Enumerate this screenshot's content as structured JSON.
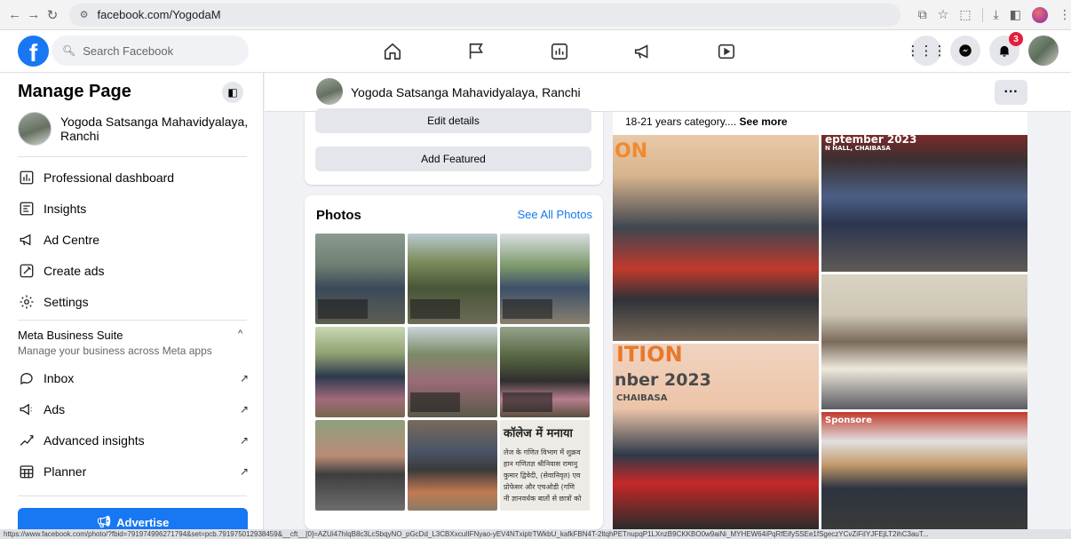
{
  "browser": {
    "url": "facebook.com/YogodaM",
    "status_url": "https://www.facebook.com/photo/?fbid=791974996271794&set=pcb.791975012938459&__cft__[0]=AZUi47hIqB8c3LcSbqyNO_pGcDd_L3CBXxcuIIFNyao-yEV4NTxiptrTWkbU_kafkFBN4T-2ltqhPETnupqP1LXnzB9CKKBO0w9aiNi_MYHEW64iPqRfEifySSEe1fSgeczYCvZiFiIYJFEjLT2ihC3auT..."
  },
  "fb": {
    "search_placeholder": "Search Facebook",
    "notif_count": "3"
  },
  "sidebar": {
    "title": "Manage Page",
    "page_name": "Yogoda Satsanga Mahavidyalaya, Ranchi",
    "items": [
      {
        "label": "Professional dashboard",
        "icon": "dashboard-icon"
      },
      {
        "label": "Insights",
        "icon": "insights-icon"
      },
      {
        "label": "Ad Centre",
        "icon": "megaphone-icon"
      },
      {
        "label": "Create ads",
        "icon": "pencil-icon"
      },
      {
        "label": "Settings",
        "icon": "gear-icon"
      }
    ],
    "mbs_title": "Meta Business Suite",
    "mbs_sub": "Manage your business across Meta apps",
    "mbs_items": [
      {
        "label": "Inbox",
        "icon": "chat-icon"
      },
      {
        "label": "Ads",
        "icon": "ads-icon"
      },
      {
        "label": "Advanced insights",
        "icon": "trend-icon"
      },
      {
        "label": "Planner",
        "icon": "calendar-icon"
      }
    ],
    "advertise_label": "Advertise"
  },
  "header": {
    "page_name": "Yogoda Satsanga Mahavidyalaya, Ranchi",
    "more": "···"
  },
  "intro": {
    "edit_details": "Edit details",
    "add_featured": "Add Featured"
  },
  "photos": {
    "title": "Photos",
    "see_all": "See All Photos",
    "news_clip": "कॉलेज में मनाया",
    "news_lines": "लेज के गणित विभाग में शुक्रव\nहान गणितज्ञ श्रीनिवास रामानु\nकुमार द्विवेदी, (सेवानिवृत) एव\nप्रोफेसर और एचओडी (गणि\nनी ज्ञानवर्धक बातों से छात्रों को"
  },
  "post": {
    "text": "18-21 years category....",
    "see_more": "See more",
    "banner1": "ON",
    "banner2": "eptember 2023",
    "banner2_sub": "N HALL, CHAIBASA",
    "banner3": "ITION",
    "banner4": "nber 2023",
    "banner4_sub": "CHAIBASA",
    "banner5": "Sponsore"
  }
}
